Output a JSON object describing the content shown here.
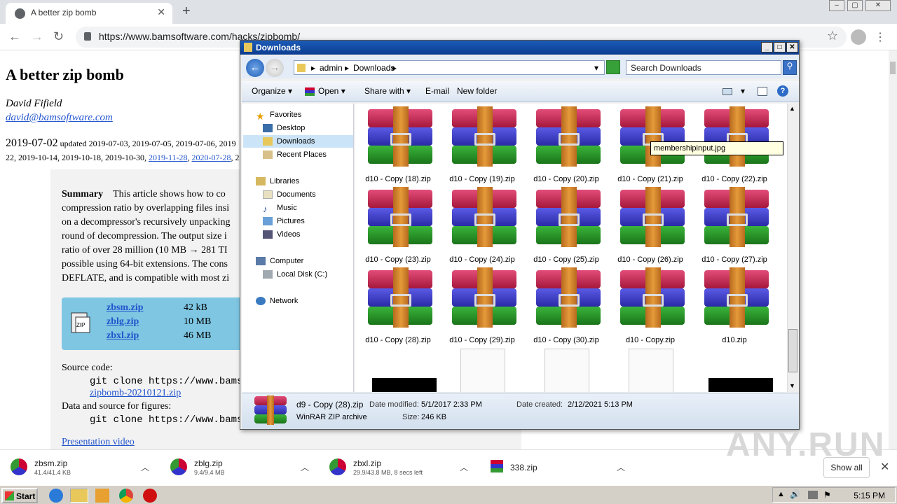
{
  "browser": {
    "tab_title": "A better zip bomb",
    "new_tab": "+",
    "url": "https://www.bamsoftware.com/hacks/zipbomb/"
  },
  "page": {
    "title": "A better zip bomb",
    "author": "David Fifield",
    "email": "david@bamsoftware.com",
    "date_main": "2019-07-02",
    "updated_prefix": " updated 2019-07-03, 2019-07-05, 2019-07-06, 2019",
    "updated_line2_a": "22, 2019-10-14, 2019-10-18, 2019-10-30, ",
    "updated_link1": "2019-11-28",
    "sep": ", ",
    "updated_link2": "2020-07-28",
    "updated_tail": ", 2",
    "summary_label": "Summary",
    "summary_lines": [
      "This article shows how to co",
      "compression ratio by overlapping files insi",
      "on a decompressor's recursively unpacking",
      "round of decompression. The output size i",
      "ratio of over 28 million (10 MB → 281 TI",
      "possible using 64-bit extensions. The cons",
      "DEFLATE, and is compatible with most zi"
    ],
    "files": [
      {
        "name": "zbsm.zip",
        "size": "42 kB"
      },
      {
        "name": "zblg.zip",
        "size": "10 MB"
      },
      {
        "name": "zbxl.zip",
        "size": "46 MB"
      }
    ],
    "source_label": "Source code:",
    "git_clone1": "git clone https://www.bamsoftwa",
    "zip_link": "zipbomb-20210121.zip",
    "data_label": "Data and source for figures:",
    "git_clone2": "git clone https://www.bamsoftwa",
    "video_link": "Presentation video"
  },
  "explorer": {
    "title": "Downloads",
    "breadcrumb": [
      "admin",
      "Downloads"
    ],
    "search_placeholder": "Search Downloads",
    "commands": [
      "Organize",
      "Open",
      "Share with",
      "E-mail",
      "New folder"
    ],
    "nav": {
      "favorites": "Favorites",
      "desktop": "Desktop",
      "downloads": "Downloads",
      "recent": "Recent Places",
      "libraries": "Libraries",
      "documents": "Documents",
      "music": "Music",
      "pictures": "Pictures",
      "videos": "Videos",
      "computer": "Computer",
      "localdisk": "Local Disk (C:)",
      "network": "Network"
    },
    "files": [
      "d10 - Copy (18).zip",
      "d10 - Copy (19).zip",
      "d10 - Copy (20).zip",
      "d10 - Copy (21).zip",
      "d10 - Copy (22).zip",
      "d10 - Copy (23).zip",
      "d10 - Copy (24).zip",
      "d10 - Copy (25).zip",
      "d10 - Copy (26).zip",
      "d10 - Copy (27).zip",
      "d10 - Copy (28).zip",
      "d10 - Copy (29).zip",
      "d10 - Copy (30).zip",
      "d10 - Copy.zip",
      "d10.zip"
    ],
    "tooltip": "membershipinput.jpg",
    "details": {
      "name": "d9 - Copy (28).zip",
      "type": "WinRAR ZIP archive",
      "modified_label": "Date modified:",
      "modified": "5/1/2017 2:33 PM",
      "size_label": "Size:",
      "size": "246 KB",
      "created_label": "Date created:",
      "created": "2/12/2021 5:13 PM"
    }
  },
  "downloads": [
    {
      "name": "zbsm.zip",
      "status": "41.4/41.4 KB"
    },
    {
      "name": "zblg.zip",
      "status": "9.4/9.4 MB"
    },
    {
      "name": "zbxl.zip",
      "status": "29.9/43.8 MB, 8 secs left"
    },
    {
      "name": "338.zip",
      "status": ""
    }
  ],
  "show_all": "Show all",
  "taskbar": {
    "start": "Start",
    "clock": "5:15 PM"
  },
  "watermark": "ANY.RUN"
}
